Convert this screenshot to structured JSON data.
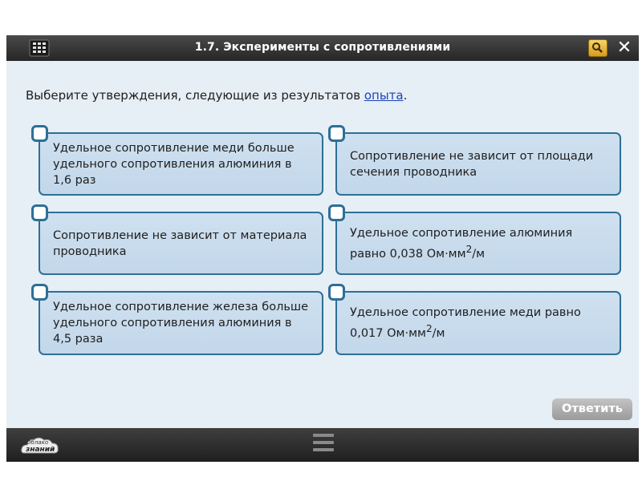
{
  "header": {
    "title": "1.7. Эксперименты с сопротивлениями",
    "close_label": "✕"
  },
  "prompt": {
    "text": "Выберите утверждения, следующие из результатов ",
    "link": "опыта",
    "suffix": "."
  },
  "options": [
    {
      "text": "Удельное сопротивление меди больше удельного сопротивления алюминия в 1,6 раз",
      "checked": false
    },
    {
      "text": "Сопротивление не зависит от площади сечения проводника",
      "checked": false
    },
    {
      "text": "Сопротивление не зависит от материала проводника",
      "checked": false
    },
    {
      "text": "Удельное сопротивление алюминия равно 0,038 Ом·мм",
      "sup": "2",
      "after": "/м",
      "checked": false
    },
    {
      "text": "Удельное сопротивление железа больше удельного сопротивления алюминия в 4,5 раза",
      "checked": false
    },
    {
      "text": "Удельное сопротивление меди равно 0,017 Ом·мм",
      "sup": "2",
      "after": "/м",
      "checked": false
    }
  ],
  "answer_button": {
    "label": "Ответить"
  },
  "footer": {
    "logo_line1": "Облако",
    "logo_line2": "знаний"
  },
  "icons": {
    "menu": "grid-menu-icon",
    "search": "magnifier-icon",
    "close": "close-icon",
    "handle": "handle-icon"
  },
  "colors": {
    "option_border": "#2e6f95",
    "option_fill": "#c8dcee",
    "background": "#e6eef6",
    "bar": "#2b2b2b",
    "link": "#1a43b8"
  }
}
